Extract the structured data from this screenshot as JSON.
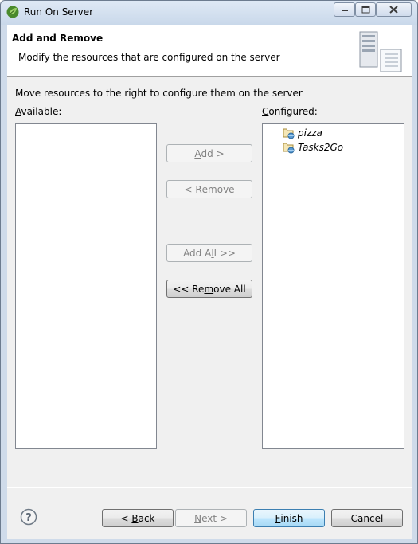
{
  "window": {
    "title": "Run On Server"
  },
  "header": {
    "title": "Add and Remove",
    "description": "Modify the resources that are configured on the server"
  },
  "instruction": "Move resources to the right to configure them on the server",
  "available": {
    "label": "Available:",
    "mnemonic": "A",
    "label_rest": "vailable:",
    "items": []
  },
  "configured": {
    "label": "Configured:",
    "mnemonic": "C",
    "label_rest": "onfigured:",
    "items": [
      {
        "label": "pizza",
        "icon": "web-project-icon"
      },
      {
        "label": "Tasks2Go",
        "icon": "web-project-icon"
      }
    ]
  },
  "buttons": {
    "add": {
      "pre": "",
      "mn": "A",
      "post": "dd >",
      "enabled": false
    },
    "remove": {
      "pre": "< ",
      "mn": "R",
      "post": "emove",
      "enabled": false
    },
    "add_all": {
      "pre": "Add A",
      "mn": "l",
      "post": "l >>",
      "enabled": false
    },
    "remove_all": {
      "pre": "<< Re",
      "mn": "m",
      "post": "ove All",
      "enabled": true
    },
    "back": {
      "pre": "< ",
      "mn": "B",
      "post": "ack",
      "enabled": true
    },
    "next": {
      "pre": "",
      "mn": "N",
      "post": "ext >",
      "enabled": false
    },
    "finish": {
      "pre": "",
      "mn": "F",
      "post": "inish",
      "enabled": true
    },
    "cancel": {
      "pre": "Cancel",
      "mn": "",
      "post": "",
      "enabled": true
    }
  },
  "colors": {
    "titlebar": "#cfdbea",
    "default_button_border": "#3c7fb1",
    "disabled_text": "#838383"
  }
}
